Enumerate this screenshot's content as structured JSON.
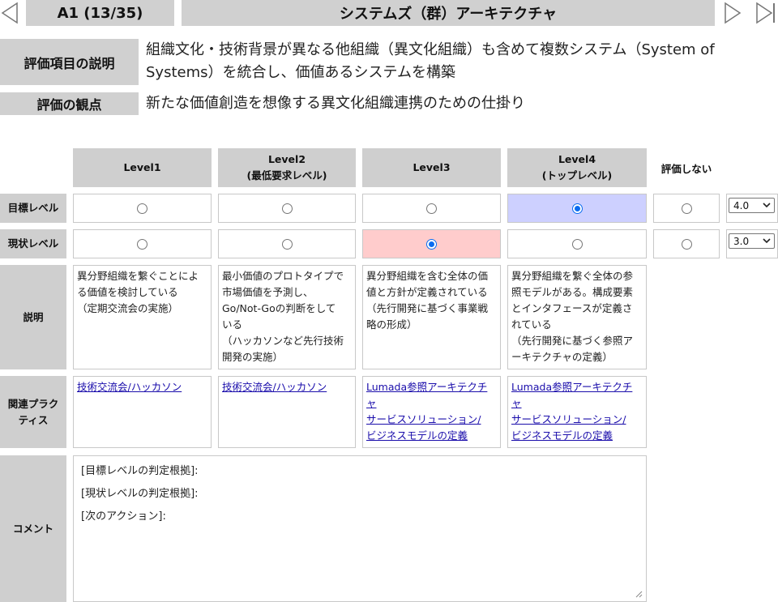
{
  "header": {
    "item_id": "A1 (13/35)",
    "title": "システムズ（群）アーキテクチャ"
  },
  "description": {
    "label": "評価項目の説明",
    "text_line1": "組織文化・技術背景が異なる他組織（異文化組織）も含めて複数システム（System of",
    "text_line2": "Systems）を統合し、価値あるシステムを構築"
  },
  "viewpoint": {
    "label": "評価の観点",
    "text": "新たな価値創造を想像する異文化組織連携のための仕掛り"
  },
  "columns": [
    {
      "line1": "Level1",
      "line2": ""
    },
    {
      "line1": "Level2",
      "line2": "(最低要求レベル)"
    },
    {
      "line1": "Level3",
      "line2": ""
    },
    {
      "line1": "Level4",
      "line2": "(トップレベル)"
    }
  ],
  "no_eval_label": "評価しない",
  "rows": {
    "target": {
      "label": "目標レベル",
      "selected_index": 3,
      "value": "4.0"
    },
    "current": {
      "label": "現状レベル",
      "selected_index": 2,
      "value": "3.0"
    },
    "explanation": {
      "label": "説明"
    },
    "practice": {
      "label_line1": "関連プラク",
      "label_line2": "ティス"
    },
    "comment": {
      "label": "コメント"
    }
  },
  "explanations": [
    [
      "異分野組織を繋ぐことによ",
      "る価値を検討している",
      "（定期交流会の実施）"
    ],
    [
      "最小価値のプロトタイプで",
      "市場価値を予測し、",
      "Go/Not-Goの判断をして",
      "いる",
      "（ハッカソンなど先行技術",
      "開発の実施）"
    ],
    [
      "異分野組織を含む全体の価",
      "値と方針が定義されている",
      "（先行開発に基づく事業戦",
      "略の形成）"
    ],
    [
      "異分野組織を繋ぐ全体の参",
      "照モデルがある。構成要素",
      "とインタフェースが定義さ",
      "れている",
      "（先行開発に基づく参照ア",
      "ーキテクチャの定義）"
    ]
  ],
  "practices": [
    [
      "技術交流会/ハッカソン"
    ],
    [
      "技術交流会/ハッカソン"
    ],
    [
      "Lumada参照アーキテクチ",
      "ャ",
      "サービスソリューション/",
      "ビジネスモデルの定義"
    ],
    [
      "Lumada参照アーキテクチ",
      "ャ",
      "サービスソリューション/",
      "ビジネスモデルの定義"
    ]
  ],
  "comment_lines": [
    "[目標レベルの判定根拠]:",
    "[現状レベルの判定根拠]:",
    "[次のアクション]:"
  ],
  "colors": {
    "header_gray": "#d0d0d0",
    "target_highlight": "#cdd0ff",
    "current_highlight": "#ffcccc",
    "radio_checked": "#0a6cf0",
    "link": "#1a0dab"
  }
}
